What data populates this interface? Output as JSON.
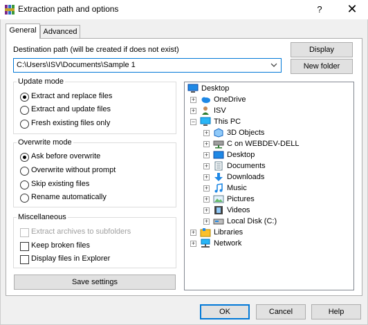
{
  "window": {
    "title": "Extraction path and options",
    "help_glyph": "?",
    "close_glyph": "✕"
  },
  "tabs": [
    {
      "label": "General",
      "active": true
    },
    {
      "label": "Advanced",
      "active": false
    }
  ],
  "destination": {
    "label": "Destination path (will be created if does not exist)",
    "value": "C:\\Users\\ISV\\Documents\\Sample 1",
    "display_button": "Display",
    "new_folder_button": "New folder"
  },
  "update_mode": {
    "title": "Update mode",
    "options": [
      {
        "label": "Extract and replace files",
        "selected": true
      },
      {
        "label": "Extract and update files",
        "selected": false
      },
      {
        "label": "Fresh existing files only",
        "selected": false
      }
    ]
  },
  "overwrite_mode": {
    "title": "Overwrite mode",
    "options": [
      {
        "label": "Ask before overwrite",
        "selected": true
      },
      {
        "label": "Overwrite without prompt",
        "selected": false
      },
      {
        "label": "Skip existing files",
        "selected": false
      },
      {
        "label": "Rename automatically",
        "selected": false
      }
    ]
  },
  "miscellaneous": {
    "title": "Miscellaneous",
    "options": [
      {
        "label": "Extract archives to subfolders",
        "checked": false,
        "disabled": true
      },
      {
        "label": "Keep broken files",
        "checked": false,
        "disabled": false
      },
      {
        "label": "Display files in Explorer",
        "checked": false,
        "disabled": false
      }
    ]
  },
  "save_settings_button": "Save settings",
  "tree": {
    "root": "Desktop",
    "items": [
      {
        "label": "OneDrive",
        "icon": "cloud-icon"
      },
      {
        "label": "ISV",
        "icon": "user-icon"
      },
      {
        "label": "This PC",
        "icon": "computer-icon"
      },
      {
        "label": "3D Objects",
        "icon": "cube-icon"
      },
      {
        "label": "C on WEBDEV-DELL",
        "icon": "network-drive-icon"
      },
      {
        "label": "Desktop",
        "icon": "desktop-folder-icon"
      },
      {
        "label": "Documents",
        "icon": "documents-icon"
      },
      {
        "label": "Downloads",
        "icon": "downloads-icon"
      },
      {
        "label": "Music",
        "icon": "music-icon"
      },
      {
        "label": "Pictures",
        "icon": "pictures-icon"
      },
      {
        "label": "Videos",
        "icon": "videos-icon"
      },
      {
        "label": "Local Disk (C:)",
        "icon": "local-disk-icon"
      },
      {
        "label": "Libraries",
        "icon": "libraries-icon"
      },
      {
        "label": "Network",
        "icon": "network-icon"
      }
    ]
  },
  "footer": {
    "ok": "OK",
    "cancel": "Cancel",
    "help": "Help"
  },
  "colors": {
    "accent": "#0078d7",
    "button_bg": "#e1e1e1",
    "dialog_bg": "#f0f0f0"
  }
}
